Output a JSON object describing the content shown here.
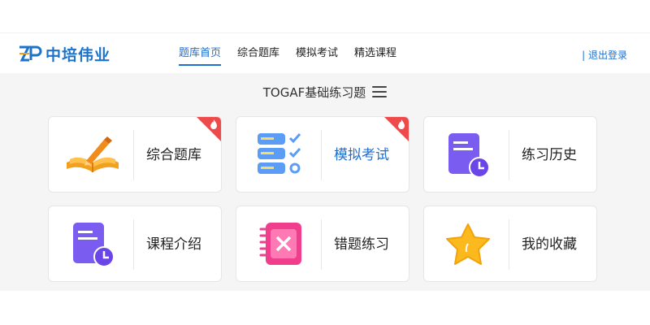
{
  "header": {
    "logo_text": "中培伟业",
    "nav": [
      "题库首页",
      "综合题库",
      "模拟考试",
      "精选课程"
    ],
    "logout": "| 退出登录"
  },
  "main": {
    "title": "TOGAF基础练习题",
    "cards": [
      {
        "label": "综合题库",
        "icon": "book-pencil-icon",
        "hot": true
      },
      {
        "label": "模拟考试",
        "icon": "checklist-icon",
        "hot": true
      },
      {
        "label": "练习历史",
        "icon": "history-clock-icon",
        "hot": false
      },
      {
        "label": "课程介绍",
        "icon": "course-clock-icon",
        "hot": false
      },
      {
        "label": "错题练习",
        "icon": "wrong-notebook-icon",
        "hot": false
      },
      {
        "label": "我的收藏",
        "icon": "star-icon",
        "hot": false
      }
    ]
  },
  "colors": {
    "accent": "#1f6fd0",
    "hot": "#ef4a4a",
    "background": "#f5f5f5"
  }
}
